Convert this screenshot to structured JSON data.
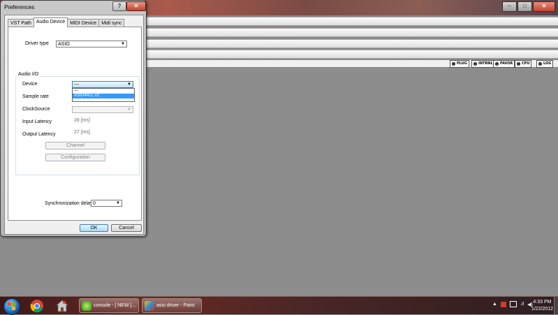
{
  "host": {
    "window_buttons": {
      "minimize": "–",
      "maximize": "□",
      "close": "✕"
    },
    "rack_buttons": [
      "PLUG",
      "INTRNL",
      "FAVOR",
      "CPU",
      "LOG"
    ]
  },
  "dialog": {
    "title": "Preferences",
    "help_label": "?",
    "close_label": "✕",
    "tabs": [
      "VST Path",
      "Audio Device",
      "MIDI Device",
      "Midi sync"
    ],
    "active_tab": "Audio Device",
    "driver_type": {
      "label": "Driver type",
      "value": "ASIO"
    },
    "audio_io": {
      "title": "Audio I/O",
      "device": {
        "label": "Device",
        "value": "---",
        "options": [
          "---",
          "ASIO4ALL v2"
        ],
        "highlighted": "ASIO4ALL v2"
      },
      "sample_rate": {
        "label": "Sample rate",
        "value": ""
      },
      "clock_source": {
        "label": "ClockSource",
        "value": ""
      },
      "input_latency": {
        "label": "Input Latency",
        "value": "28 [ms]"
      },
      "output_latency": {
        "label": "Output Latency",
        "value": "27 [ms]"
      },
      "channel_button": "Channel",
      "configuration_button": "Configuration"
    },
    "sync_delay": {
      "label": "Synchronization delay",
      "value": "0"
    },
    "ok_label": "OK",
    "cancel_label": "Cancel"
  },
  "taskbar": {
    "tasks": [
      {
        "label": "console - [ NEW ]...",
        "icon": "console-app-icon"
      },
      {
        "label": "asio driver - Paint",
        "icon": "paint-icon"
      }
    ],
    "clock_time": "4:33 PM",
    "clock_date": "1/22/2012"
  },
  "colors": {
    "selection": "#3399ff",
    "taskbar": "#4a2626",
    "workspace": "#8d8d8d"
  }
}
